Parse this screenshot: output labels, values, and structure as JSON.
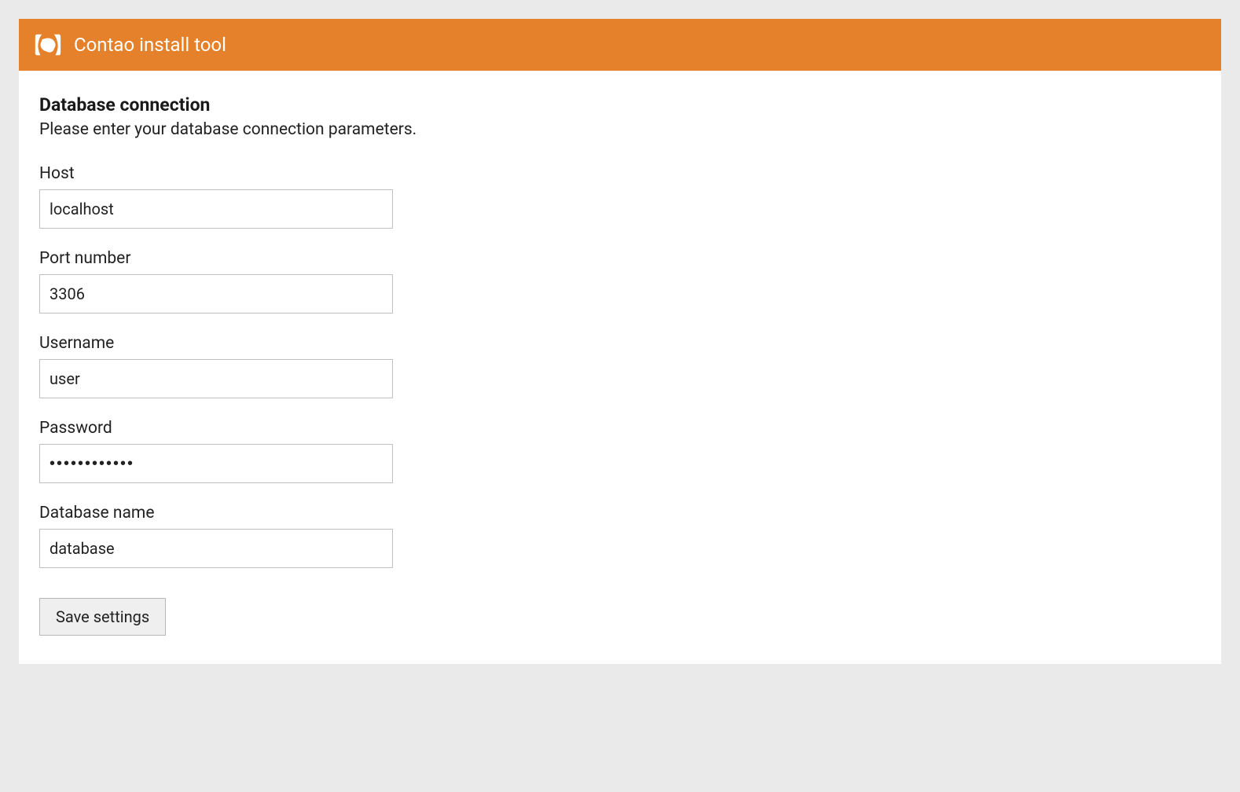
{
  "header": {
    "title": "Contao install tool"
  },
  "section": {
    "heading": "Database connection",
    "description": "Please enter your database connection parameters."
  },
  "fields": {
    "host": {
      "label": "Host",
      "value": "localhost"
    },
    "port": {
      "label": "Port number",
      "value": "3306"
    },
    "username": {
      "label": "Username",
      "value": "user"
    },
    "password": {
      "label": "Password",
      "value": "••••••••••••"
    },
    "database": {
      "label": "Database name",
      "value": "database"
    }
  },
  "buttons": {
    "save": "Save settings"
  }
}
